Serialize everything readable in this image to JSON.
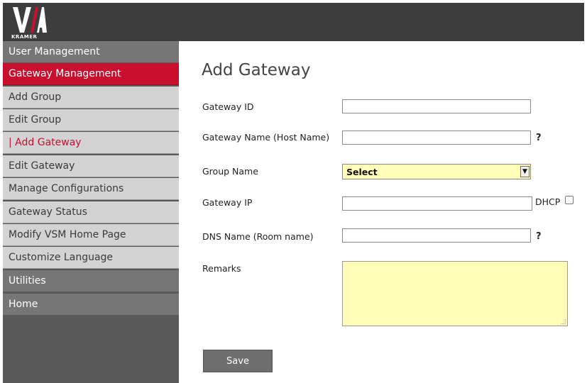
{
  "header": {
    "logo_text": "KRAMER"
  },
  "sidebar": {
    "items": [
      {
        "label": "User Management"
      },
      {
        "label": "Gateway Management"
      },
      {
        "label": "Add Group"
      },
      {
        "label": "Edit Group"
      },
      {
        "label": "| Add Gateway"
      },
      {
        "label": "Edit Gateway"
      },
      {
        "label": "Manage Configurations"
      },
      {
        "label": "Gateway Status"
      },
      {
        "label": "Modify VSM Home Page"
      },
      {
        "label": "Customize Language"
      },
      {
        "label": "Utilities"
      },
      {
        "label": "Home"
      }
    ]
  },
  "form": {
    "title": "Add Gateway",
    "gateway_id_label": "Gateway ID",
    "gateway_id_value": "",
    "gateway_name_label": "Gateway Name (Host Name)",
    "gateway_name_value": "",
    "help_mark": "?",
    "group_name_label": "Group Name",
    "group_name_selected": "Select",
    "gateway_ip_label": "Gateway IP",
    "gateway_ip_value": "",
    "dhcp_label": "DHCP",
    "dns_name_label": "DNS Name (Room name)",
    "dns_name_value": "",
    "remarks_label": "Remarks",
    "remarks_value": "",
    "save_label": "Save"
  },
  "colors": {
    "accent": "#c8102e",
    "topbar": "#3d3d3d",
    "field_highlight": "#fffdb8"
  }
}
